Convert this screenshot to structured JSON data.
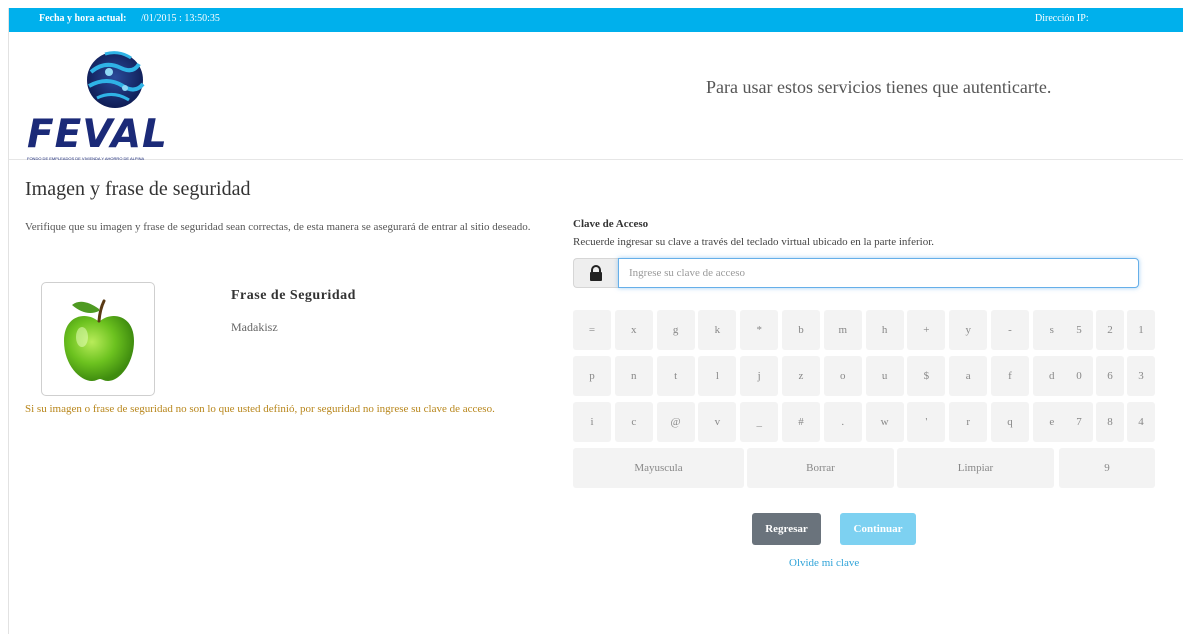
{
  "topbar": {
    "datetime_label": "Fecha y hora actual:",
    "datetime_value": "/01/2015 : 13:50:35",
    "ip_label": "Dirección IP:"
  },
  "header": {
    "logo_text": "FEVAL",
    "logo_subtitle": "FONDO DE EMPLEADOS DE VIVIENDA Y AHORRO DE ALPINA",
    "auth_message": "Para usar estos servicios tienes que autenticarte."
  },
  "security": {
    "title": "Imagen y frase de seguridad",
    "verify_text": "Verifique que su imagen y frase de seguridad sean correctas, de esta manera se asegurará de entrar al sitio deseado.",
    "image_icon": "green-apple",
    "phrase_title": "Frase de Seguridad",
    "phrase_value": "Madakisz",
    "warning": "Si su imagen o frase de seguridad no son lo que usted definió, por seguridad no ingrese su clave de acceso."
  },
  "login": {
    "clave_label": "Clave de Acceso",
    "clave_help": "Recuerde ingresar su clave a través del teclado virtual ubicado en la parte inferior.",
    "password_placeholder": "Ingrese su clave de acceso",
    "back_label": "Regresar",
    "continue_label": "Continuar",
    "forgot_label": "Olvide mi clave"
  },
  "keyboard": {
    "letters": [
      [
        "=",
        "x",
        "g",
        "k",
        "*",
        "b",
        "m",
        "h",
        "+",
        "y",
        "-",
        "s"
      ],
      [
        "p",
        "n",
        "t",
        "l",
        "j",
        "z",
        "o",
        "u",
        "$",
        "a",
        "f",
        "d"
      ],
      [
        "i",
        "c",
        "@",
        "v",
        "_",
        "#",
        ".",
        "w",
        "'",
        "r",
        "q",
        "e"
      ]
    ],
    "numbers": [
      [
        "5",
        "2",
        "1"
      ],
      [
        "0",
        "6",
        "3"
      ],
      [
        "7",
        "8",
        "4"
      ]
    ],
    "bottom": [
      "Mayuscula",
      "Borrar",
      "Limpiar",
      "9"
    ]
  },
  "colors": {
    "topbar": "#00b0ec",
    "brand_navy": "#1b2a78",
    "warning": "#b8861b",
    "back_button": "#6a737c",
    "continue_button": "#7dd1f1",
    "link": "#2fa3d8"
  }
}
